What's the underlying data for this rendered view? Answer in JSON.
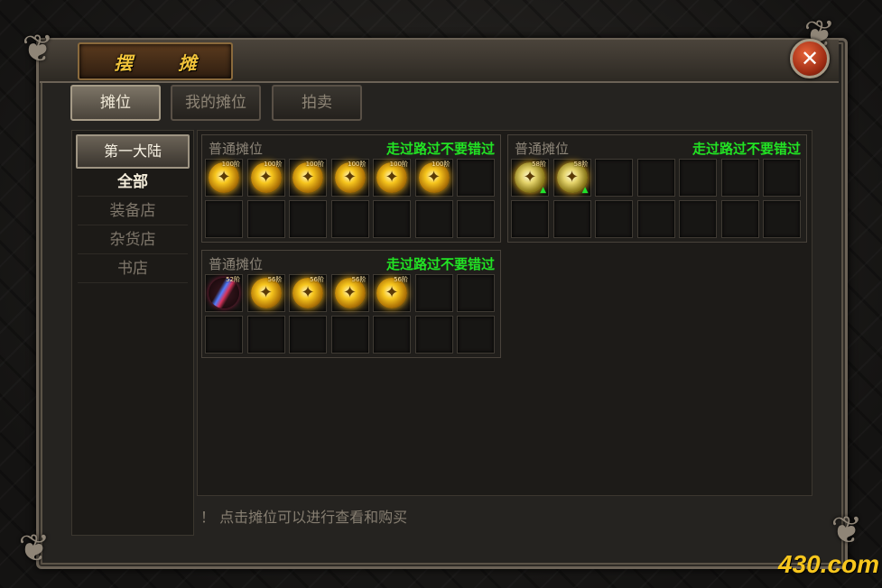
{
  "window": {
    "title": "摆 摊",
    "close_symbol": "✕"
  },
  "tabs": [
    {
      "label": "摊位",
      "active": true
    },
    {
      "label": "我的摊位",
      "active": false
    },
    {
      "label": "拍卖",
      "active": false
    }
  ],
  "sidebar": {
    "region": "第一大陆",
    "categories": [
      {
        "label": "全部",
        "active": true
      },
      {
        "label": "装备店",
        "active": false
      },
      {
        "label": "杂货店",
        "active": false
      },
      {
        "label": "书店",
        "active": false
      }
    ]
  },
  "stalls": [
    {
      "name": "普通摊位",
      "slogan": "走过路过不要错过",
      "items": [
        {
          "icon": "golden-orb-icon",
          "badge": "100阶"
        },
        {
          "icon": "golden-orb-icon",
          "badge": "100阶"
        },
        {
          "icon": "golden-orb-icon",
          "badge": "100阶"
        },
        {
          "icon": "golden-orb-icon",
          "badge": "100阶"
        },
        {
          "icon": "golden-orb-icon",
          "badge": "100阶"
        },
        {
          "icon": "golden-orb-icon",
          "badge": "100阶"
        }
      ]
    },
    {
      "name": "普通摊位",
      "slogan": "走过路过不要错过",
      "items": [
        {
          "icon": "golden-orb-icon",
          "badge": "58阶",
          "upgrade": true
        },
        {
          "icon": "golden-orb-icon",
          "badge": "58阶",
          "upgrade": true
        }
      ]
    },
    {
      "name": "普通摊位",
      "slogan": "走过路过不要错过",
      "items": [
        {
          "icon": "blade-icon",
          "badge": "52阶"
        },
        {
          "icon": "golden-orb-icon",
          "badge": "56阶"
        },
        {
          "icon": "golden-orb-icon",
          "badge": "56阶"
        },
        {
          "icon": "golden-orb-icon",
          "badge": "56阶"
        },
        {
          "icon": "golden-orb-icon",
          "badge": "56阶"
        }
      ]
    }
  ],
  "notice": "！ 点击摊位可以进行查看和购买",
  "watermark": "430.com",
  "colors": {
    "slogan": "#22e324",
    "title": "#f0c23a",
    "accent_gold": "#f7c61d"
  }
}
